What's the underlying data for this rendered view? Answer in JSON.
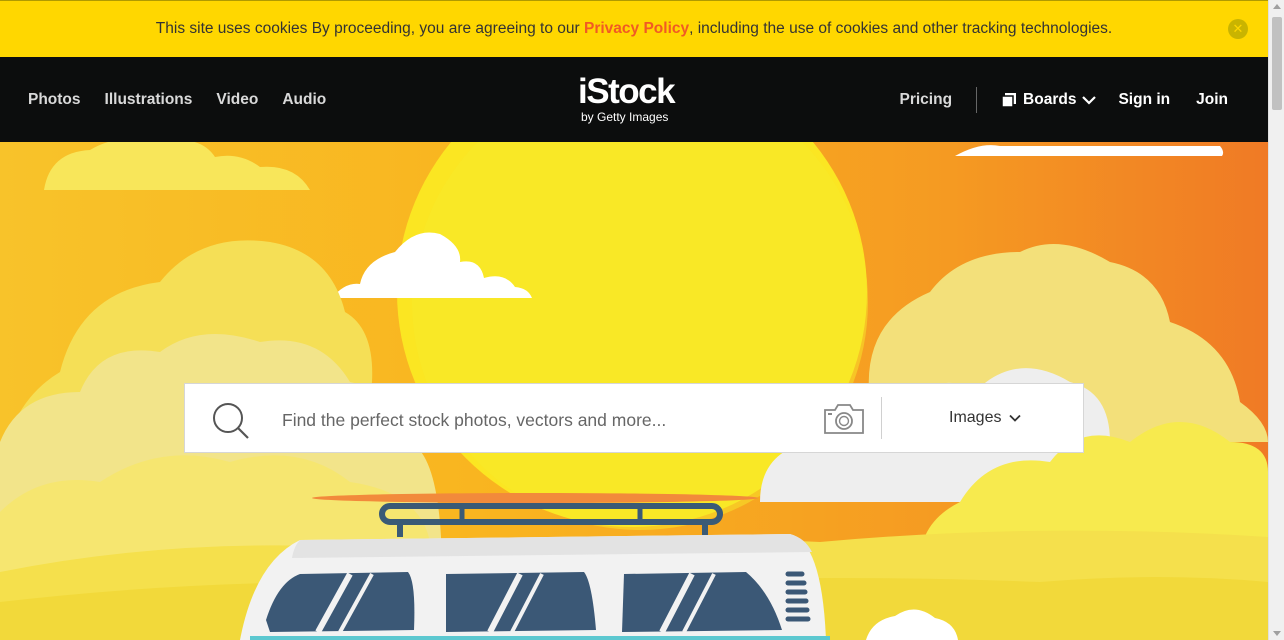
{
  "cookie_banner": {
    "text_before": "This site uses cookies By proceeding, you are agreeing to our ",
    "link_label": "Privacy Policy",
    "text_after": ", including the use of cookies and other tracking technologies.",
    "close_icon": "close-icon",
    "close_glyph": "✕"
  },
  "header": {
    "nav": [
      "Photos",
      "Illustrations",
      "Video",
      "Audio"
    ],
    "logo": {
      "brand": "iStock",
      "sub": "by Getty Images"
    },
    "pricing": "Pricing",
    "boards": "Boards",
    "signin": "Sign in",
    "join": "Join"
  },
  "search": {
    "placeholder": "Find the perfect stock photos, vectors and more...",
    "type_selected": "Images",
    "search_icon": "search-icon",
    "camera_icon": "camera-icon"
  },
  "colors": {
    "banner": "#ffd700",
    "link": "#f15a24",
    "header_bg": "#0c0d0d",
    "sun": "#fbe622"
  }
}
